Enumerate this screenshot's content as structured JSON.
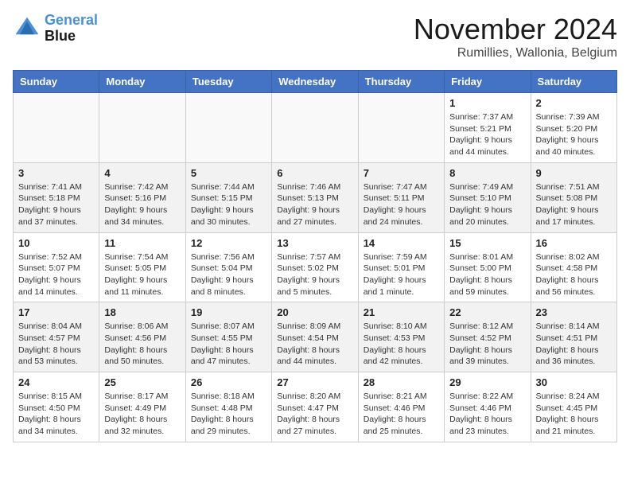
{
  "header": {
    "logo_line1": "General",
    "logo_line2": "Blue",
    "month_title": "November 2024",
    "location": "Rumillies, Wallonia, Belgium"
  },
  "days_of_week": [
    "Sunday",
    "Monday",
    "Tuesday",
    "Wednesday",
    "Thursday",
    "Friday",
    "Saturday"
  ],
  "weeks": [
    [
      {
        "day": "",
        "info": ""
      },
      {
        "day": "",
        "info": ""
      },
      {
        "day": "",
        "info": ""
      },
      {
        "day": "",
        "info": ""
      },
      {
        "day": "",
        "info": ""
      },
      {
        "day": "1",
        "info": "Sunrise: 7:37 AM\nSunset: 5:21 PM\nDaylight: 9 hours and 44 minutes."
      },
      {
        "day": "2",
        "info": "Sunrise: 7:39 AM\nSunset: 5:20 PM\nDaylight: 9 hours and 40 minutes."
      }
    ],
    [
      {
        "day": "3",
        "info": "Sunrise: 7:41 AM\nSunset: 5:18 PM\nDaylight: 9 hours and 37 minutes."
      },
      {
        "day": "4",
        "info": "Sunrise: 7:42 AM\nSunset: 5:16 PM\nDaylight: 9 hours and 34 minutes."
      },
      {
        "day": "5",
        "info": "Sunrise: 7:44 AM\nSunset: 5:15 PM\nDaylight: 9 hours and 30 minutes."
      },
      {
        "day": "6",
        "info": "Sunrise: 7:46 AM\nSunset: 5:13 PM\nDaylight: 9 hours and 27 minutes."
      },
      {
        "day": "7",
        "info": "Sunrise: 7:47 AM\nSunset: 5:11 PM\nDaylight: 9 hours and 24 minutes."
      },
      {
        "day": "8",
        "info": "Sunrise: 7:49 AM\nSunset: 5:10 PM\nDaylight: 9 hours and 20 minutes."
      },
      {
        "day": "9",
        "info": "Sunrise: 7:51 AM\nSunset: 5:08 PM\nDaylight: 9 hours and 17 minutes."
      }
    ],
    [
      {
        "day": "10",
        "info": "Sunrise: 7:52 AM\nSunset: 5:07 PM\nDaylight: 9 hours and 14 minutes."
      },
      {
        "day": "11",
        "info": "Sunrise: 7:54 AM\nSunset: 5:05 PM\nDaylight: 9 hours and 11 minutes."
      },
      {
        "day": "12",
        "info": "Sunrise: 7:56 AM\nSunset: 5:04 PM\nDaylight: 9 hours and 8 minutes."
      },
      {
        "day": "13",
        "info": "Sunrise: 7:57 AM\nSunset: 5:02 PM\nDaylight: 9 hours and 5 minutes."
      },
      {
        "day": "14",
        "info": "Sunrise: 7:59 AM\nSunset: 5:01 PM\nDaylight: 9 hours and 1 minute."
      },
      {
        "day": "15",
        "info": "Sunrise: 8:01 AM\nSunset: 5:00 PM\nDaylight: 8 hours and 59 minutes."
      },
      {
        "day": "16",
        "info": "Sunrise: 8:02 AM\nSunset: 4:58 PM\nDaylight: 8 hours and 56 minutes."
      }
    ],
    [
      {
        "day": "17",
        "info": "Sunrise: 8:04 AM\nSunset: 4:57 PM\nDaylight: 8 hours and 53 minutes."
      },
      {
        "day": "18",
        "info": "Sunrise: 8:06 AM\nSunset: 4:56 PM\nDaylight: 8 hours and 50 minutes."
      },
      {
        "day": "19",
        "info": "Sunrise: 8:07 AM\nSunset: 4:55 PM\nDaylight: 8 hours and 47 minutes."
      },
      {
        "day": "20",
        "info": "Sunrise: 8:09 AM\nSunset: 4:54 PM\nDaylight: 8 hours and 44 minutes."
      },
      {
        "day": "21",
        "info": "Sunrise: 8:10 AM\nSunset: 4:53 PM\nDaylight: 8 hours and 42 minutes."
      },
      {
        "day": "22",
        "info": "Sunrise: 8:12 AM\nSunset: 4:52 PM\nDaylight: 8 hours and 39 minutes."
      },
      {
        "day": "23",
        "info": "Sunrise: 8:14 AM\nSunset: 4:51 PM\nDaylight: 8 hours and 36 minutes."
      }
    ],
    [
      {
        "day": "24",
        "info": "Sunrise: 8:15 AM\nSunset: 4:50 PM\nDaylight: 8 hours and 34 minutes."
      },
      {
        "day": "25",
        "info": "Sunrise: 8:17 AM\nSunset: 4:49 PM\nDaylight: 8 hours and 32 minutes."
      },
      {
        "day": "26",
        "info": "Sunrise: 8:18 AM\nSunset: 4:48 PM\nDaylight: 8 hours and 29 minutes."
      },
      {
        "day": "27",
        "info": "Sunrise: 8:20 AM\nSunset: 4:47 PM\nDaylight: 8 hours and 27 minutes."
      },
      {
        "day": "28",
        "info": "Sunrise: 8:21 AM\nSunset: 4:46 PM\nDaylight: 8 hours and 25 minutes."
      },
      {
        "day": "29",
        "info": "Sunrise: 8:22 AM\nSunset: 4:46 PM\nDaylight: 8 hours and 23 minutes."
      },
      {
        "day": "30",
        "info": "Sunrise: 8:24 AM\nSunset: 4:45 PM\nDaylight: 8 hours and 21 minutes."
      }
    ]
  ]
}
